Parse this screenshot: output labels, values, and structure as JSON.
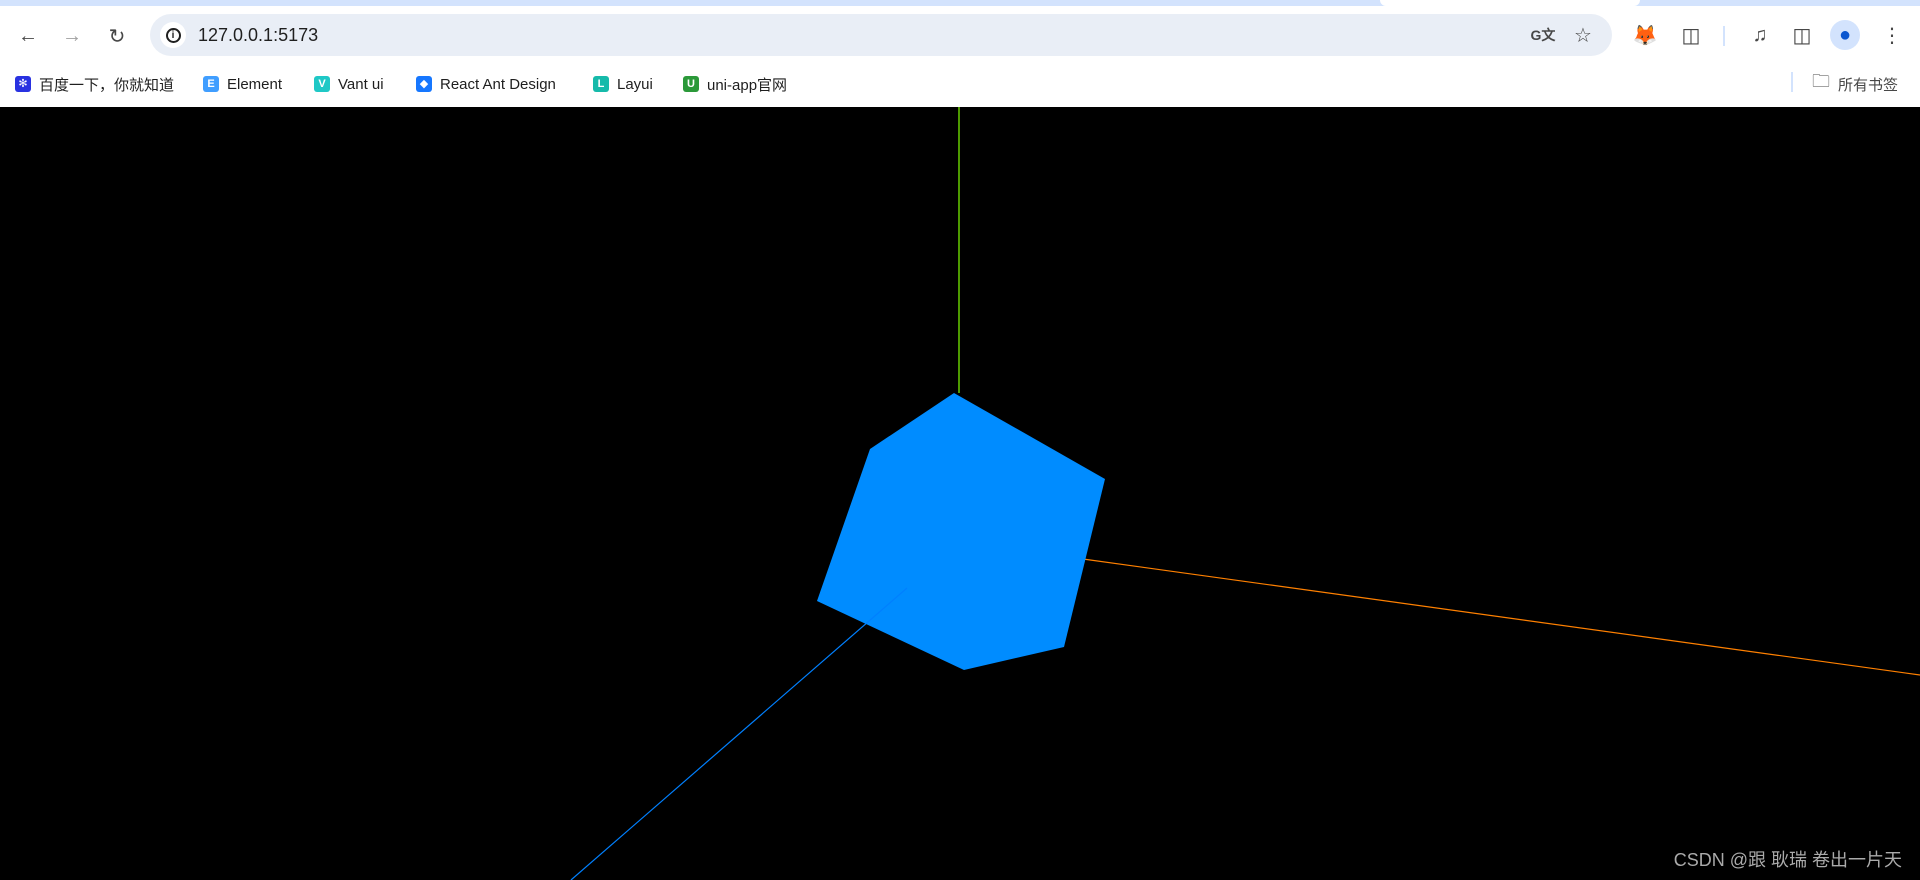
{
  "browser": {
    "url": "127.0.0.1:5173",
    "bookmarks": [
      {
        "label": "百度一下，你就知道",
        "icon": "baidu-paw-icon",
        "color": "#2932e1"
      },
      {
        "label": "Element",
        "icon": "element-icon",
        "color": "#409eff"
      },
      {
        "label": "Vant ui",
        "icon": "vant-icon",
        "color": "#1fc8c6"
      },
      {
        "label": "React Ant Design",
        "icon": "ant-design-icon",
        "color": "#1677ff"
      },
      {
        "label": "Layui",
        "icon": "layui-icon",
        "color": "#16baaa"
      },
      {
        "label": "uni-app官网",
        "icon": "uni-app-icon",
        "color": "#2b9939"
      }
    ],
    "all_bookmarks": "所有书签"
  },
  "scene": {
    "background": "#000000",
    "cube_color": "#008cff",
    "axes": {
      "x_color": "#ff8000",
      "y_color": "#80ff00",
      "z_color": "#0080ff"
    }
  },
  "watermark": "CSDN @跟 耿瑞 卷出一片天"
}
